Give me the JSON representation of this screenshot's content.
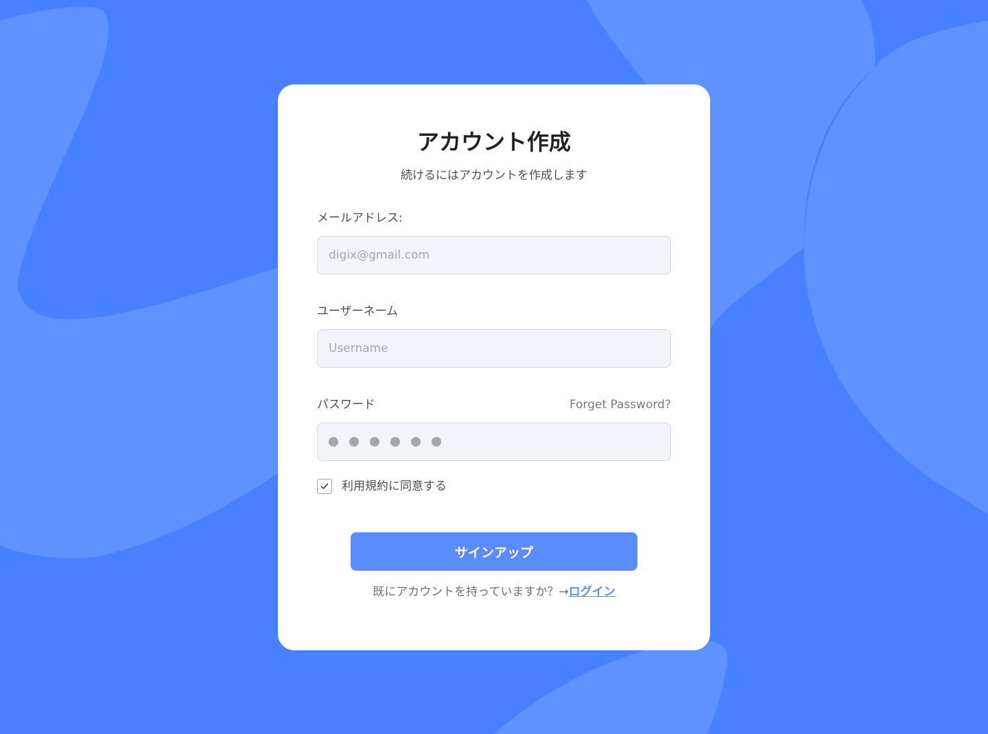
{
  "colors": {
    "background": "#4880ff",
    "background_shape": "#5f91ff",
    "card": "#ffffff",
    "accent": "#5a8cff",
    "field_bg": "#f1f4f9",
    "field_border": "#d8d8d8",
    "text_primary": "#202224"
  },
  "card": {
    "title": "アカウント作成",
    "subtitle": "続けるにはアカウントを作成します"
  },
  "email": {
    "label": "メールアドレス:",
    "placeholder": "digix@gmail.com"
  },
  "username": {
    "label": "ユーザーネーム",
    "placeholder": "Username"
  },
  "password": {
    "label": "パスワード",
    "forgot_link": "Forget Password?",
    "masked_char_count": 6
  },
  "terms": {
    "label": "利用規約に同意する",
    "checked": true
  },
  "signup_button": {
    "label": "サインアップ"
  },
  "login_prompt": {
    "text": "既にアカウントを持っていますか？→",
    "link": "ログイン"
  },
  "icons": {
    "checkbox": "check-icon",
    "password_mask": "dot-icon"
  }
}
